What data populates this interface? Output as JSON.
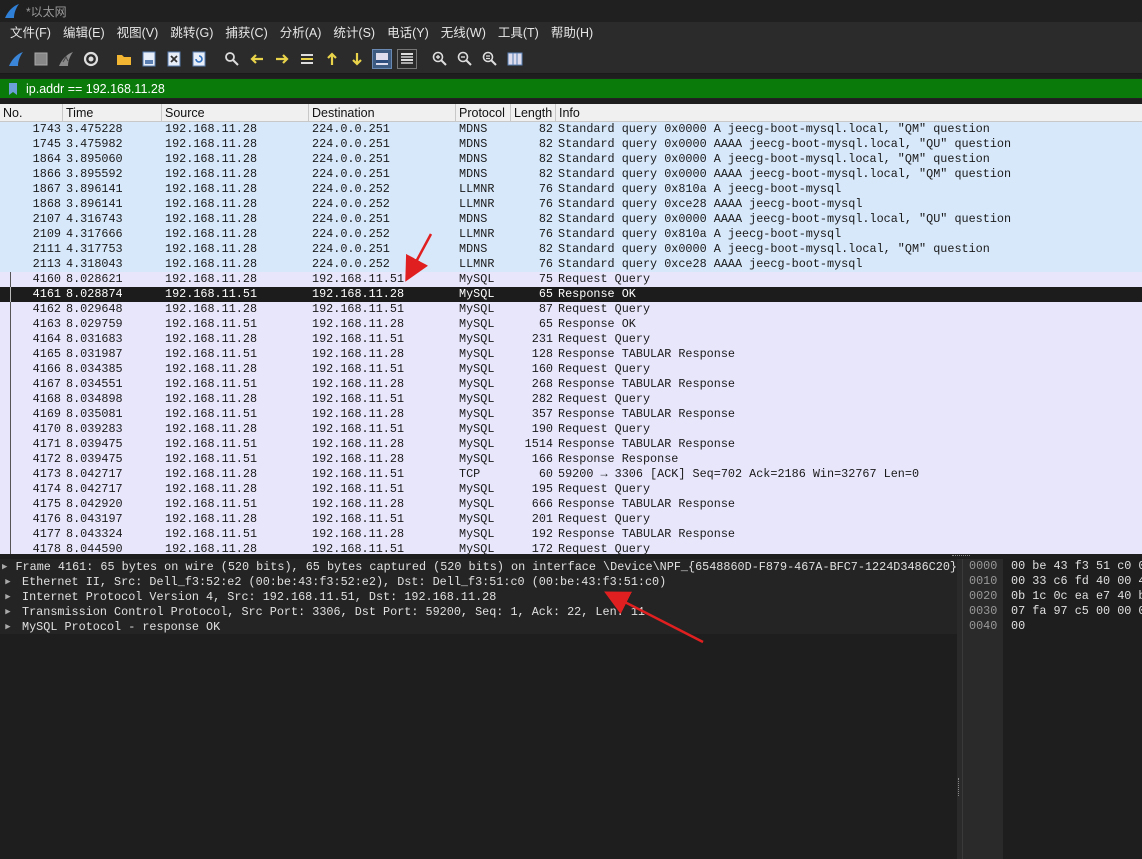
{
  "window": {
    "title": "*以太网"
  },
  "menu": [
    "文件(F)",
    "编辑(E)",
    "视图(V)",
    "跳转(G)",
    "捕获(C)",
    "分析(A)",
    "统计(S)",
    "电话(Y)",
    "无线(W)",
    "工具(T)",
    "帮助(H)"
  ],
  "toolbar": {
    "icons": [
      "shark-fin-start-icon",
      "stop-square-icon",
      "restart-fin-icon",
      "capture-options-gear-icon",
      "open-folder-icon",
      "save-file-icon",
      "close-file-icon",
      "reload-icon",
      "find-magnifier-icon",
      "go-back-arrow-icon",
      "go-forward-arrow-icon",
      "go-to-packet-icon",
      "go-first-icon",
      "go-last-icon",
      "auto-scroll-icon",
      "colorize-icon",
      "zoom-in-icon",
      "zoom-out-icon",
      "zoom-normal-icon",
      "resize-columns-icon"
    ]
  },
  "filter": {
    "value": "ip.addr == 192.168.11.28"
  },
  "packet_list": {
    "headers": [
      "No.",
      "Time",
      "Source",
      "Destination",
      "Protocol",
      "Length",
      "Info"
    ],
    "rows": [
      {
        "no": "1743",
        "time": "3.475228",
        "src": "192.168.11.28",
        "dst": "224.0.0.251",
        "proto": "MDNS",
        "len": "82",
        "info": "Standard query 0x0000 A jeecg-boot-mysql.local, \"QM\" question",
        "kind": "mdns"
      },
      {
        "no": "1745",
        "time": "3.475982",
        "src": "192.168.11.28",
        "dst": "224.0.0.251",
        "proto": "MDNS",
        "len": "82",
        "info": "Standard query 0x0000 AAAA jeecg-boot-mysql.local, \"QU\" question",
        "kind": "mdns"
      },
      {
        "no": "1864",
        "time": "3.895060",
        "src": "192.168.11.28",
        "dst": "224.0.0.251",
        "proto": "MDNS",
        "len": "82",
        "info": "Standard query 0x0000 A jeecg-boot-mysql.local, \"QM\" question",
        "kind": "mdns"
      },
      {
        "no": "1866",
        "time": "3.895592",
        "src": "192.168.11.28",
        "dst": "224.0.0.251",
        "proto": "MDNS",
        "len": "82",
        "info": "Standard query 0x0000 AAAA jeecg-boot-mysql.local, \"QM\" question",
        "kind": "mdns"
      },
      {
        "no": "1867",
        "time": "3.896141",
        "src": "192.168.11.28",
        "dst": "224.0.0.252",
        "proto": "LLMNR",
        "len": "76",
        "info": "Standard query 0x810a A jeecg-boot-mysql",
        "kind": "mdns"
      },
      {
        "no": "1868",
        "time": "3.896141",
        "src": "192.168.11.28",
        "dst": "224.0.0.252",
        "proto": "LLMNR",
        "len": "76",
        "info": "Standard query 0xce28 AAAA jeecg-boot-mysql",
        "kind": "mdns"
      },
      {
        "no": "2107",
        "time": "4.316743",
        "src": "192.168.11.28",
        "dst": "224.0.0.251",
        "proto": "MDNS",
        "len": "82",
        "info": "Standard query 0x0000 AAAA jeecg-boot-mysql.local, \"QU\" question",
        "kind": "mdns"
      },
      {
        "no": "2109",
        "time": "4.317666",
        "src": "192.168.11.28",
        "dst": "224.0.0.252",
        "proto": "LLMNR",
        "len": "76",
        "info": "Standard query 0x810a A jeecg-boot-mysql",
        "kind": "mdns"
      },
      {
        "no": "2111",
        "time": "4.317753",
        "src": "192.168.11.28",
        "dst": "224.0.0.251",
        "proto": "MDNS",
        "len": "82",
        "info": "Standard query 0x0000 A jeecg-boot-mysql.local, \"QM\" question",
        "kind": "mdns"
      },
      {
        "no": "2113",
        "time": "4.318043",
        "src": "192.168.11.28",
        "dst": "224.0.0.252",
        "proto": "LLMNR",
        "len": "76",
        "info": "Standard query 0xce28 AAAA jeecg-boot-mysql",
        "kind": "mdns"
      },
      {
        "no": "4160",
        "time": "8.028621",
        "src": "192.168.11.28",
        "dst": "192.168.11.51",
        "proto": "MySQL",
        "len": "75",
        "info": "Request Query",
        "kind": "mysql"
      },
      {
        "no": "4161",
        "time": "8.028874",
        "src": "192.168.11.51",
        "dst": "192.168.11.28",
        "proto": "MySQL",
        "len": "65",
        "info": "Response  OK",
        "kind": "selected"
      },
      {
        "no": "4162",
        "time": "8.029648",
        "src": "192.168.11.28",
        "dst": "192.168.11.51",
        "proto": "MySQL",
        "len": "87",
        "info": "Request Query",
        "kind": "mysql"
      },
      {
        "no": "4163",
        "time": "8.029759",
        "src": "192.168.11.51",
        "dst": "192.168.11.28",
        "proto": "MySQL",
        "len": "65",
        "info": "Response  OK",
        "kind": "mysql"
      },
      {
        "no": "4164",
        "time": "8.031683",
        "src": "192.168.11.28",
        "dst": "192.168.11.51",
        "proto": "MySQL",
        "len": "231",
        "info": "Request Query",
        "kind": "mysql"
      },
      {
        "no": "4165",
        "time": "8.031987",
        "src": "192.168.11.51",
        "dst": "192.168.11.28",
        "proto": "MySQL",
        "len": "128",
        "info": "Response TABULAR Response",
        "kind": "mysql"
      },
      {
        "no": "4166",
        "time": "8.034385",
        "src": "192.168.11.28",
        "dst": "192.168.11.51",
        "proto": "MySQL",
        "len": "160",
        "info": "Request Query",
        "kind": "mysql"
      },
      {
        "no": "4167",
        "time": "8.034551",
        "src": "192.168.11.51",
        "dst": "192.168.11.28",
        "proto": "MySQL",
        "len": "268",
        "info": "Response TABULAR Response",
        "kind": "mysql"
      },
      {
        "no": "4168",
        "time": "8.034898",
        "src": "192.168.11.28",
        "dst": "192.168.11.51",
        "proto": "MySQL",
        "len": "282",
        "info": "Request Query",
        "kind": "mysql"
      },
      {
        "no": "4169",
        "time": "8.035081",
        "src": "192.168.11.51",
        "dst": "192.168.11.28",
        "proto": "MySQL",
        "len": "357",
        "info": "Response TABULAR Response",
        "kind": "mysql"
      },
      {
        "no": "4170",
        "time": "8.039283",
        "src": "192.168.11.28",
        "dst": "192.168.11.51",
        "proto": "MySQL",
        "len": "190",
        "info": "Request Query",
        "kind": "mysql"
      },
      {
        "no": "4171",
        "time": "8.039475",
        "src": "192.168.11.51",
        "dst": "192.168.11.28",
        "proto": "MySQL",
        "len": "1514",
        "info": "Response TABULAR Response",
        "kind": "mysql"
      },
      {
        "no": "4172",
        "time": "8.039475",
        "src": "192.168.11.51",
        "dst": "192.168.11.28",
        "proto": "MySQL",
        "len": "166",
        "info": "Response Response",
        "kind": "mysql"
      },
      {
        "no": "4173",
        "time": "8.042717",
        "src": "192.168.11.28",
        "dst": "192.168.11.51",
        "proto": "TCP",
        "len": "60",
        "info": "59200 → 3306 [ACK] Seq=702 Ack=2186 Win=32767 Len=0",
        "kind": "mysql"
      },
      {
        "no": "4174",
        "time": "8.042717",
        "src": "192.168.11.28",
        "dst": "192.168.11.51",
        "proto": "MySQL",
        "len": "195",
        "info": "Request Query",
        "kind": "mysql"
      },
      {
        "no": "4175",
        "time": "8.042920",
        "src": "192.168.11.51",
        "dst": "192.168.11.28",
        "proto": "MySQL",
        "len": "666",
        "info": "Response TABULAR Response",
        "kind": "mysql"
      },
      {
        "no": "4176",
        "time": "8.043197",
        "src": "192.168.11.28",
        "dst": "192.168.11.51",
        "proto": "MySQL",
        "len": "201",
        "info": "Request Query",
        "kind": "mysql"
      },
      {
        "no": "4177",
        "time": "8.043324",
        "src": "192.168.11.51",
        "dst": "192.168.11.28",
        "proto": "MySQL",
        "len": "192",
        "info": "Response TABULAR Response",
        "kind": "mysql"
      },
      {
        "no": "4178",
        "time": "8.044590",
        "src": "192.168.11.28",
        "dst": "192.168.11.51",
        "proto": "MySQL",
        "len": "172",
        "info": "Request Query",
        "kind": "mysql"
      }
    ]
  },
  "details": [
    "Frame 4161: 65 bytes on wire (520 bits), 65 bytes captured (520 bits) on interface \\Device\\NPF_{6548860D-F879-467A-BFC7-1224D3486C20}",
    "Ethernet II, Src: Dell_f3:52:e2 (00:be:43:f3:52:e2), Dst: Dell_f3:51:c0 (00:be:43:f3:51:c0)",
    "Internet Protocol Version 4, Src: 192.168.11.51, Dst: 192.168.11.28",
    "Transmission Control Protocol, Src Port: 3306, Dst Port: 59200, Seq: 1, Ack: 22, Len: 11",
    "MySQL Protocol - response OK"
  ],
  "bytes": {
    "offsets": [
      "0000",
      "0010",
      "0020",
      "0030",
      "0040"
    ],
    "hex": [
      "00 be 43 f3 51 c0 0",
      "00 33 c6 fd 40 00 4",
      "0b 1c 0c ea e7 40 b",
      "07 fa 97 c5 00 00 0",
      "00"
    ]
  },
  "colors": {
    "filter_bg": "#0a7a0a",
    "mdns_row": "#d7e8fa",
    "mysql_row": "#e8e6fb",
    "selected_row": "#1c1c1c",
    "annotation_arrow": "#e02020"
  }
}
